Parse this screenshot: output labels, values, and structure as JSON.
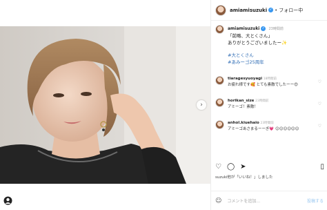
{
  "colors": {
    "accent": "#3897f0",
    "hashtag": "#2f6db5",
    "border": "#efefef"
  },
  "header": {
    "username": "amiamisuzuki",
    "separator": "•",
    "follow_label": "フォロー中",
    "verified_icon": "verified-badge-icon"
  },
  "caption": {
    "username": "amiamisuzuki",
    "time": "23時間前",
    "lines": [
      "「前略、大とくさん」",
      "ありがとうございましたー✨"
    ],
    "hashtags": [
      "#大とくさん",
      "#あみーゴ25周年"
    ]
  },
  "comments": [
    {
      "user": "tiaragesyuoyagi",
      "time": "18時間前",
      "text": "お疲れ様です🥰 とても素敵でしたーー😍"
    },
    {
      "user": "horikan_size",
      "time": "23時間前",
      "text": "アミーゴ！素敵！"
    },
    {
      "user": "anhol.kiuehaio",
      "time": "23時間前",
      "text": "アミーゴあさまるーーぎ💗 ☺☺☺☺☺☺"
    }
  ],
  "actions": {
    "like": "heart-icon",
    "comment": "comment-icon",
    "share": "share-icon",
    "save": "bookmark-icon"
  },
  "liked_by": "suzuki他が「いいね！」しました",
  "date": "",
  "comment_box": {
    "placeholder": "コメントを追加...",
    "post_label": "投稿する"
  },
  "carousel": {
    "next_glyph": "›"
  }
}
